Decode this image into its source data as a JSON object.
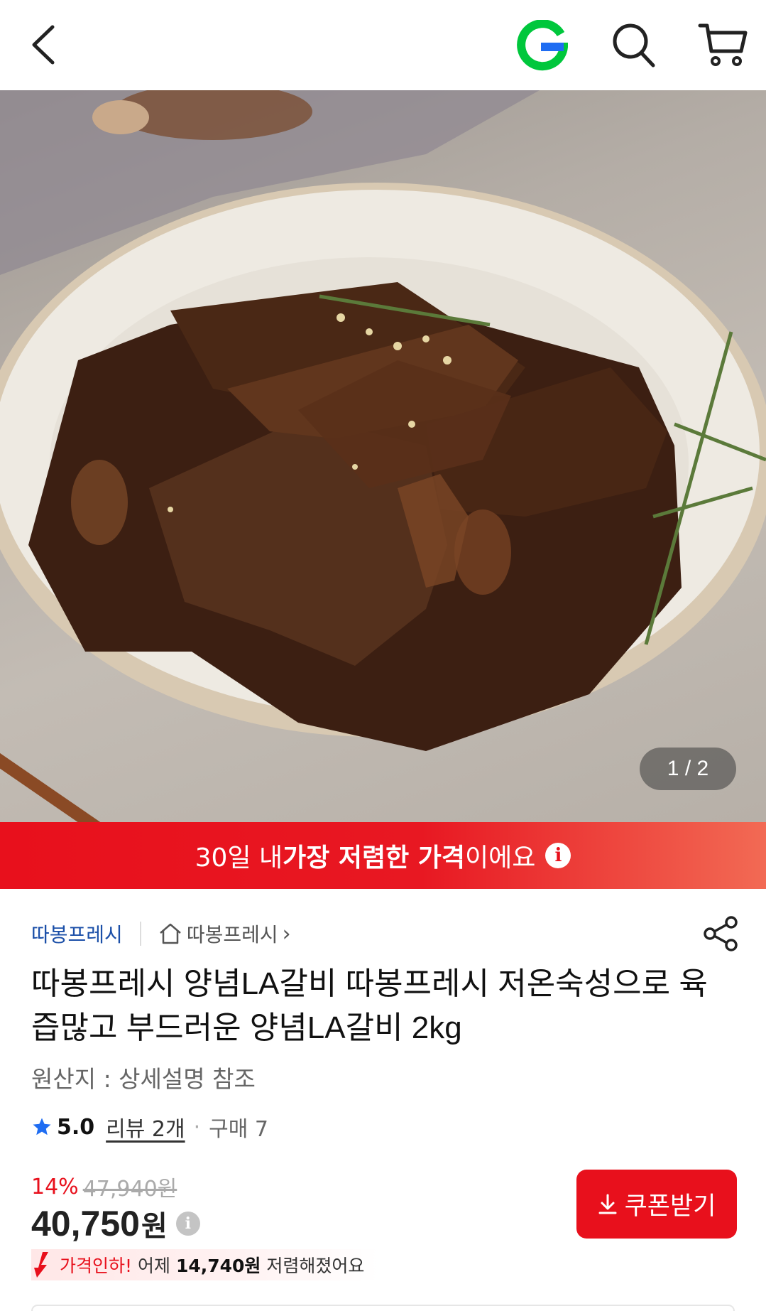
{
  "header": {
    "back_icon": "chevron-left-icon",
    "logo_letter": "G",
    "logo_color": "#00c73c",
    "search_icon": "search-icon",
    "cart_icon": "cart-icon"
  },
  "gallery": {
    "current": "1",
    "separator": "/",
    "total": "2"
  },
  "banner": {
    "prefix": "30일 내 ",
    "highlight1": "가장 저렴한 가격",
    "suffix": "이에요",
    "info_icon": "i",
    "color": "#e8101c"
  },
  "seller": {
    "name": "따봉프레시",
    "store_name": "따봉프레시",
    "store_chevron": "›"
  },
  "product": {
    "title": "따봉프레시 양념LA갈비 따봉프레시 저온숙성으로 육즙많고 부드러운 양념LA갈비 2kg",
    "origin": "원산지 : 상세설명 참조"
  },
  "rating": {
    "score": "5.0",
    "review_text": "리뷰 2개",
    "separator": "·",
    "purchase_text": "구매 7"
  },
  "price": {
    "discount": "14%",
    "original": "47,940원",
    "sale": "40,750",
    "unit": "원",
    "info_icon": "i"
  },
  "price_drop": {
    "prefix": "가격인하!",
    "middle": " 어제 ",
    "amount": "14,740원",
    "suffix": " 저렴해졌어요"
  },
  "coupon": {
    "label": "쿠폰받기",
    "icon": "download-icon"
  }
}
